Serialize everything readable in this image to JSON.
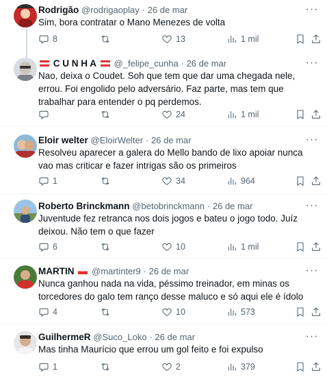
{
  "tweets": [
    {
      "name": "Rodrigão",
      "handle": "@rodrigaoplay",
      "date": "26 de mar",
      "text": "Sim, bora contratar o Mano Menezes de volta",
      "replies": "8",
      "retweets": "",
      "likes": "13",
      "views": "1 mil"
    },
    {
      "name": "C U N H A",
      "handle": "@_felipe_cunha",
      "date": "26 de mar",
      "text": "Nao, deixa o Coudet. Soh que tem que dar uma chegada nele, errou. Foi engolido pelo adversário. Faz parte, mas tem que trabalhar para entender o pq perdemos.",
      "replies": "",
      "retweets": "",
      "likes": "24",
      "views": "1 mil"
    },
    {
      "name": "Eloir welter",
      "handle": "@EloirWelter",
      "date": "26 de mar",
      "text": "Resolveu aparecer a galera do Mello bando de lixo apoiar nunca vao mas criticar e fazer intrigas são os primeiros",
      "replies": "1",
      "retweets": "",
      "likes": "34",
      "views": "964"
    },
    {
      "name": "Roberto Brinckmann",
      "handle": "@betobrinckmann",
      "date": "26 de mar",
      "text": "Juventude fez retranca nos dois jogos e bateu o jogo todo. Juíz deixou. Não tem o que fazer",
      "replies": "6",
      "retweets": "",
      "likes": "10",
      "views": "1 mil"
    },
    {
      "name": "MARTIN",
      "handle": "@martinter9",
      "date": "26 de mar",
      "text": "Nunca ganhou nada na vida,  péssimo treinador, em minas os torcedores do galo tem ranço desse maluco e só aqui ele é ídolo",
      "replies": "4",
      "retweets": "",
      "likes": "10",
      "views": "573"
    },
    {
      "name": "GuilhermeR",
      "handle": "@Suco_Loko",
      "date": "26 de mar",
      "text": "Mas tinha Maurício que errou um gol feito e foi expulso",
      "replies": "1",
      "retweets": "",
      "likes": "2",
      "views": "379"
    }
  ],
  "separator": "·",
  "more_label": "···",
  "colors": {
    "text": "#0f1419",
    "muted": "#536471",
    "divider": "#eff3f4",
    "flag_red": "#e0302e"
  }
}
